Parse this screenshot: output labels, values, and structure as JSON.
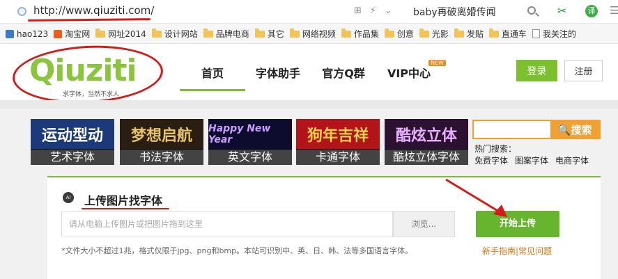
{
  "browser": {
    "url_prefix": "http://www.",
    "url_domain": "qiuziti",
    "url_suffix": ".com/",
    "search_query": "baby再破离婚传闻",
    "translate_icon_text": "译"
  },
  "bookmarks": [
    {
      "label": "hao123",
      "icon": "hao123-icon"
    },
    {
      "label": "淘宝网",
      "icon": "taobao-icon"
    },
    {
      "label": "网址2014",
      "icon": "folder-icon"
    },
    {
      "label": "设计网站",
      "icon": "folder-icon"
    },
    {
      "label": "品牌电商",
      "icon": "folder-icon"
    },
    {
      "label": "其它",
      "icon": "folder-icon"
    },
    {
      "label": "网络视频",
      "icon": "folder-icon"
    },
    {
      "label": "作品集",
      "icon": "folder-icon"
    },
    {
      "label": "创意",
      "icon": "folder-icon"
    },
    {
      "label": "光影",
      "icon": "folder-icon"
    },
    {
      "label": "发贴",
      "icon": "folder-icon"
    },
    {
      "label": "直通车",
      "icon": "folder-icon"
    },
    {
      "label": "我关注的",
      "icon": "page-icon"
    }
  ],
  "site": {
    "logo_text": "Qiuziti",
    "slogan": "求字体，当然不求人",
    "nav": [
      {
        "label": "首页",
        "active": true
      },
      {
        "label": "字体助手",
        "active": false
      },
      {
        "label": "官方Q群",
        "active": false
      },
      {
        "label": "VIP中心",
        "active": false
      }
    ],
    "nav_badge": "NEW",
    "login_label": "登录",
    "register_label": "注册",
    "accent_color": "#7cbf2f"
  },
  "categories": [
    {
      "art": "运动型动",
      "label": "艺术字体",
      "bg": "#1c3a7a",
      "color": "#ffffff"
    },
    {
      "art": "梦想启航",
      "label": "书法字体",
      "bg": "#2a1e12",
      "color": "#e7c46a"
    },
    {
      "art": "Happy New Year",
      "label": "英文字体",
      "bg": "#0d0b2e",
      "color": "#c99cff"
    },
    {
      "art": "狗年吉祥",
      "label": "卡通字体",
      "bg": "#b3141a",
      "color": "#ffd24a"
    },
    {
      "art": "酷炫立体",
      "label": "酷炫立体字体",
      "bg": "#2a1230",
      "color": "#e8b0ff"
    }
  ],
  "search": {
    "button_label": "搜索",
    "hot_label": "热门搜索：",
    "hot_links": [
      "免费字体",
      "图案字体",
      "电商字体"
    ]
  },
  "upload": {
    "title": "上传图片找字体",
    "icon_text": "Ai",
    "placeholder": "请从电脑上传图片或把图片拖到这里",
    "browse_label": "浏览...",
    "start_label": "开始上传",
    "note": "*文件大小不超过1兆，格式仅限于jpg、png和bmp。本站可识别中、英、日、韩、法等多国语言字体。",
    "help_links": [
      "新手指南",
      "常见问题"
    ]
  }
}
